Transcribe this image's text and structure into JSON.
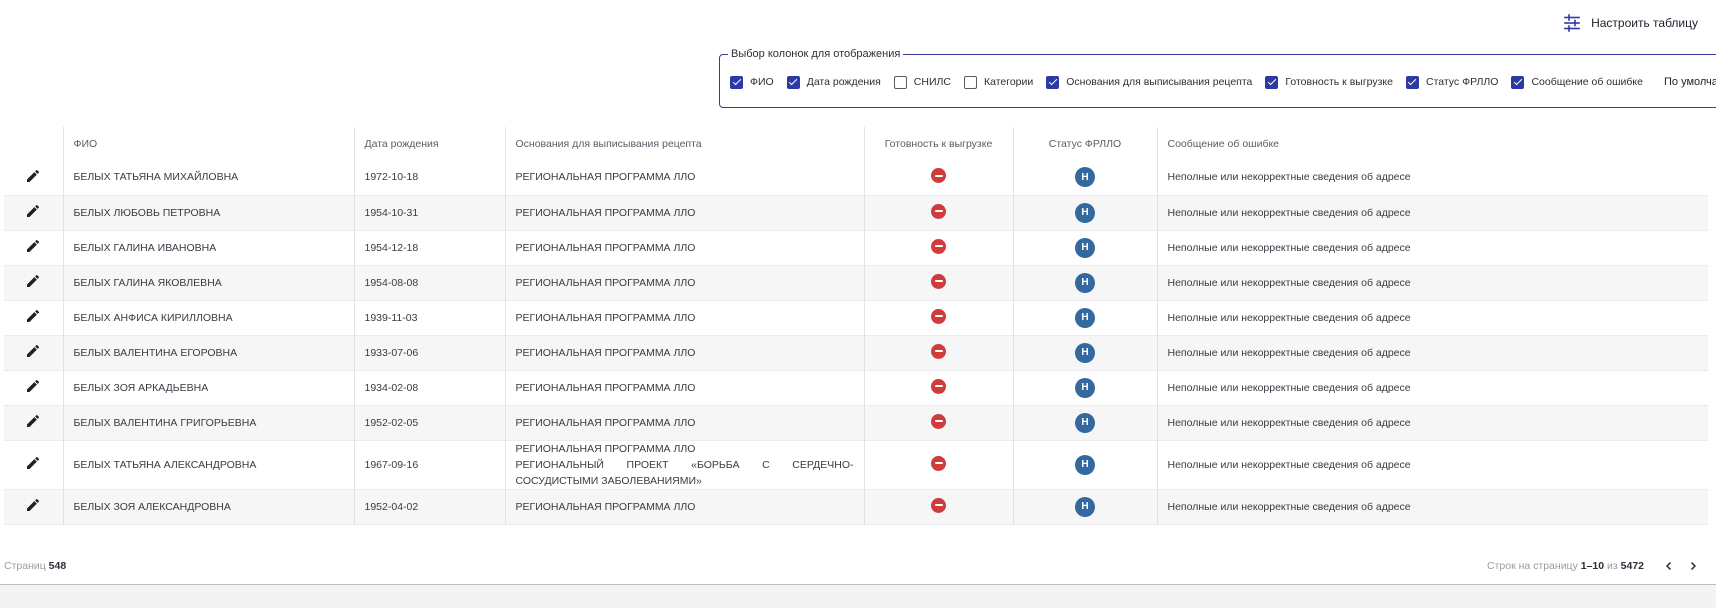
{
  "toolbar": {
    "configure_label": "Настроить таблицу",
    "configure_icon": "tune-icon"
  },
  "column_picker": {
    "legend": "Выбор колонок для отображения",
    "options": [
      {
        "label": "ФИО",
        "checked": true
      },
      {
        "label": "Дата рождения",
        "checked": true
      },
      {
        "label": "СНИЛС",
        "checked": false
      },
      {
        "label": "Категории",
        "checked": false
      },
      {
        "label": "Основания для выписывания рецепта",
        "checked": true
      },
      {
        "label": "Готовность к выгрузке",
        "checked": true
      },
      {
        "label": "Статус ФРЛЛО",
        "checked": true
      },
      {
        "label": "Сообщение об ошибке",
        "checked": true
      }
    ],
    "default_label": "По умолчанию"
  },
  "table": {
    "headers": {
      "fio": "ФИО",
      "birth": "Дата рождения",
      "basis": "Основания для выписывания рецепта",
      "ready": "Готовность к выгрузке",
      "status": "Статус ФРЛЛО",
      "error": "Сообщение об ошибке"
    },
    "rows": [
      {
        "fio": "БЕЛЫХ ТАТЬЯНА МИХАЙЛОВНА",
        "birth": "1972-10-18",
        "basis": [
          "РЕГИОНАЛЬНАЯ ПРОГРАММА ЛЛО"
        ],
        "status": "Н",
        "error": "Неполные или некорректные сведения об адресе"
      },
      {
        "fio": "БЕЛЫХ ЛЮБОВЬ ПЕТРОВНА",
        "birth": "1954-10-31",
        "basis": [
          "РЕГИОНАЛЬНАЯ ПРОГРАММА ЛЛО"
        ],
        "status": "Н",
        "error": "Неполные или некорректные сведения об адресе"
      },
      {
        "fio": "БЕЛЫХ ГАЛИНА ИВАНОВНА",
        "birth": "1954-12-18",
        "basis": [
          "РЕГИОНАЛЬНАЯ ПРОГРАММА ЛЛО"
        ],
        "status": "Н",
        "error": "Неполные или некорректные сведения об адресе"
      },
      {
        "fio": "БЕЛЫХ ГАЛИНА ЯКОВЛЕВНА",
        "birth": "1954-08-08",
        "basis": [
          "РЕГИОНАЛЬНАЯ ПРОГРАММА ЛЛО"
        ],
        "status": "Н",
        "error": "Неполные или некорректные сведения об адресе"
      },
      {
        "fio": "БЕЛЫХ АНФИСА КИРИЛЛОВНА",
        "birth": "1939-11-03",
        "basis": [
          "РЕГИОНАЛЬНАЯ ПРОГРАММА ЛЛО"
        ],
        "status": "Н",
        "error": "Неполные или некорректные сведения об адресе"
      },
      {
        "fio": "БЕЛЫХ ВАЛЕНТИНА ЕГОРОВНА",
        "birth": "1933-07-06",
        "basis": [
          "РЕГИОНАЛЬНАЯ ПРОГРАММА ЛЛО"
        ],
        "status": "Н",
        "error": "Неполные или некорректные сведения об адресе"
      },
      {
        "fio": "БЕЛЫХ ЗОЯ АРКАДЬЕВНА",
        "birth": "1934-02-08",
        "basis": [
          "РЕГИОНАЛЬНАЯ ПРОГРАММА ЛЛО"
        ],
        "status": "Н",
        "error": "Неполные или некорректные сведения об адресе"
      },
      {
        "fio": "БЕЛЫХ ВАЛЕНТИНА ГРИГОРЬЕВНА",
        "birth": "1952-02-05",
        "basis": [
          "РЕГИОНАЛЬНАЯ ПРОГРАММА ЛЛО"
        ],
        "status": "Н",
        "error": "Неполные или некорректные сведения об адресе"
      },
      {
        "fio": "БЕЛЫХ ТАТЬЯНА АЛЕКСАНДРОВНА",
        "birth": "1967-09-16",
        "basis": [
          "РЕГИОНАЛЬНАЯ ПРОГРАММА ЛЛО",
          "РЕГИОНАЛЬНЫЙ ПРОЕКТ «БОРЬБА С СЕРДЕЧНО-СОСУДИСТЫМИ ЗАБОЛЕВАНИЯМИ»"
        ],
        "status": "Н",
        "error": "Неполные или некорректные сведения об адресе"
      },
      {
        "fio": "БЕЛЫХ ЗОЯ АЛЕКСАНДРОВНА",
        "birth": "1952-04-02",
        "basis": [
          "РЕГИОНАЛЬНАЯ ПРОГРАММА ЛЛО"
        ],
        "status": "Н",
        "error": "Неполные или некорректные сведения об адресе"
      }
    ]
  },
  "footer": {
    "pages_label": "Страниц",
    "pages_count": "548",
    "rows_per_page_label": "Строк на страницу",
    "range": "1–10",
    "of_label": "из",
    "total": "5472"
  },
  "colors": {
    "accent": "#2e39a5",
    "error_status": "#d23b3b",
    "badge": "#33699e"
  }
}
